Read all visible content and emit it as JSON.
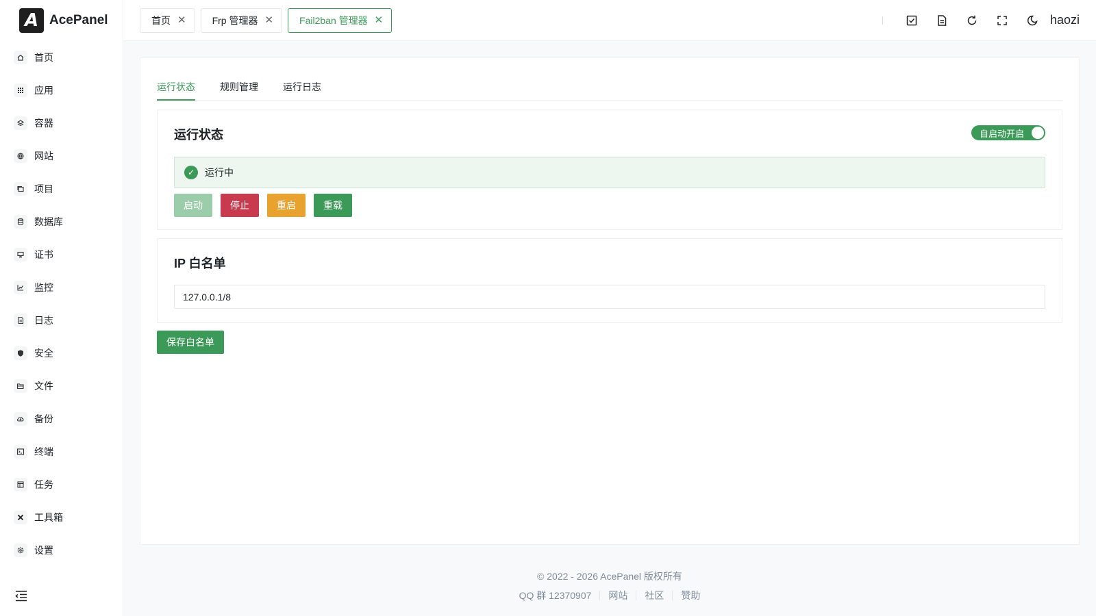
{
  "brand": {
    "logo_letter": "A",
    "name": "AcePanel"
  },
  "sidebar": {
    "items": [
      {
        "label": "首页",
        "icon": "home-icon"
      },
      {
        "label": "应用",
        "icon": "grid-icon"
      },
      {
        "label": "容器",
        "icon": "layers-icon"
      },
      {
        "label": "网站",
        "icon": "globe-icon"
      },
      {
        "label": "项目",
        "icon": "folder-stack-icon"
      },
      {
        "label": "数据库",
        "icon": "database-icon"
      },
      {
        "label": "证书",
        "icon": "certificate-icon"
      },
      {
        "label": "监控",
        "icon": "chart-icon"
      },
      {
        "label": "日志",
        "icon": "document-icon"
      },
      {
        "label": "安全",
        "icon": "shield-icon"
      },
      {
        "label": "文件",
        "icon": "folder-open-icon"
      },
      {
        "label": "备份",
        "icon": "cloud-icon"
      },
      {
        "label": "终端",
        "icon": "terminal-icon"
      },
      {
        "label": "任务",
        "icon": "task-icon"
      },
      {
        "label": "工具箱",
        "icon": "tools-icon"
      },
      {
        "label": "设置",
        "icon": "gear-icon"
      }
    ]
  },
  "header": {
    "tabs": [
      {
        "label": "首页"
      },
      {
        "label": "Frp 管理器"
      },
      {
        "label": "Fail2ban 管理器",
        "active": true
      }
    ],
    "username": "haozi"
  },
  "main": {
    "tabs": [
      "运行状态",
      "规则管理",
      "运行日志"
    ],
    "status_panel": {
      "title": "运行状态",
      "autostart_label": "自启动开启",
      "status_text": "运行中",
      "buttons": {
        "start": "启动",
        "stop": "停止",
        "restart": "重启",
        "reload": "重载"
      }
    },
    "whitelist_panel": {
      "title": "IP 白名单",
      "value": "127.0.0.1/8"
    },
    "save_label": "保存白名单"
  },
  "footer": {
    "copyright": "© 2022 - 2026 AcePanel 版权所有",
    "links": [
      "QQ 群 12370907",
      "网站",
      "社区",
      "赞助"
    ]
  },
  "colors": {
    "accent": "#3c9a58",
    "danger": "#c83a4d",
    "warning": "#e8a22f"
  }
}
